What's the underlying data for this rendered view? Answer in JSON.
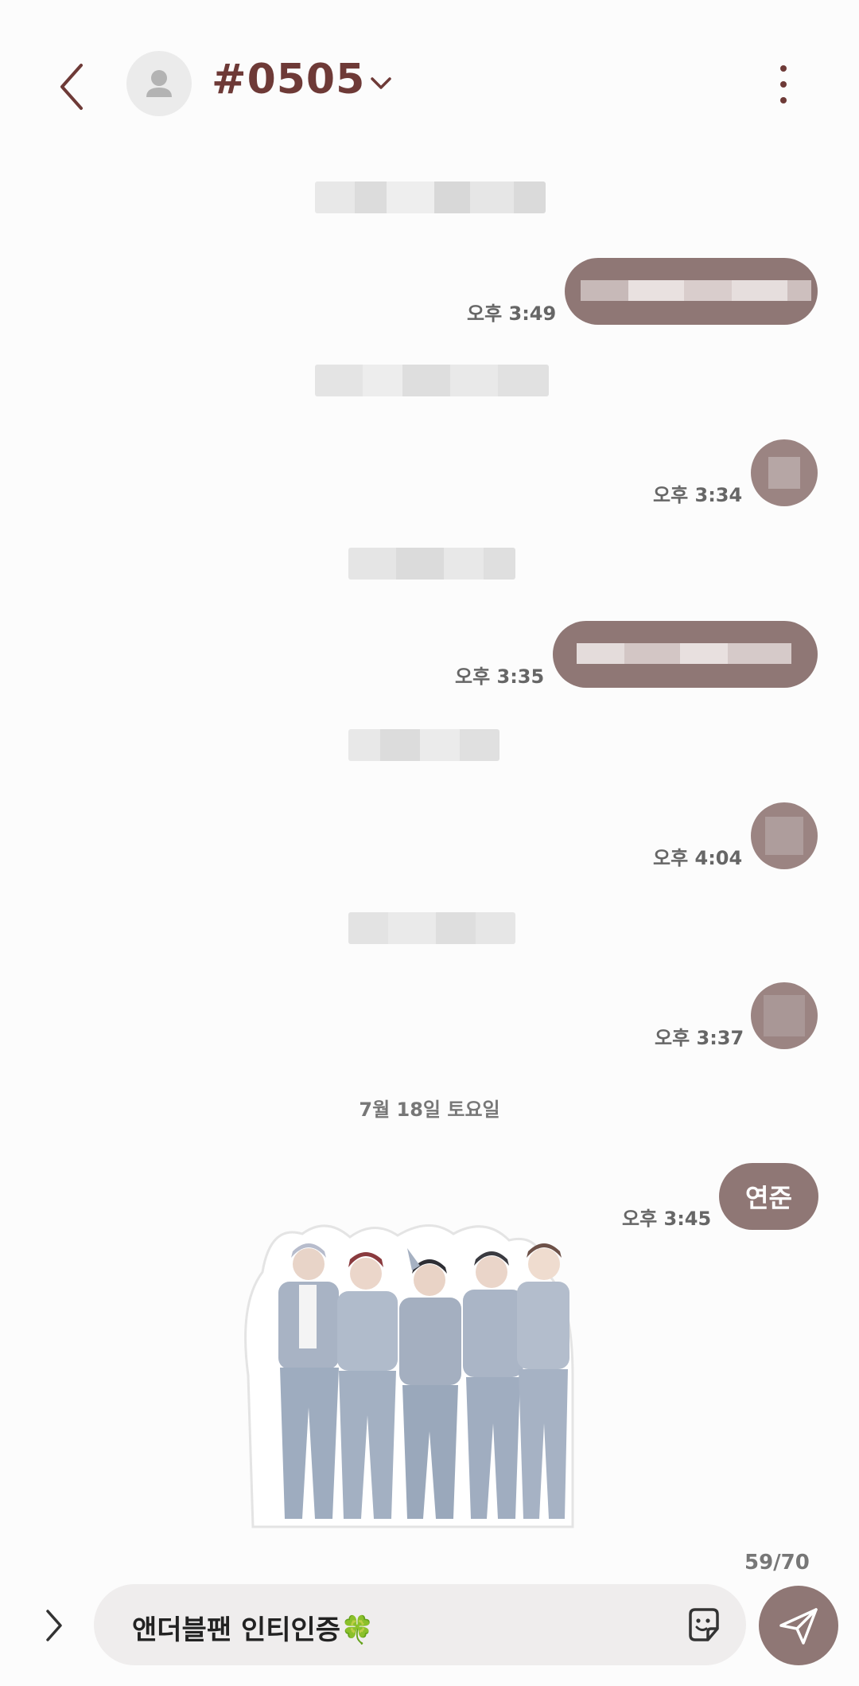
{
  "header": {
    "back_icon": "chevron-left-icon",
    "avatar_icon": "person-icon",
    "title": "#0505",
    "title_dropdown_icon": "chevron-down-icon",
    "more_icon": "more-vertical-icon"
  },
  "messages": [
    {
      "time": "오후 3:49"
    },
    {
      "time": "오후 3:34"
    },
    {
      "time": "오후 3:35"
    },
    {
      "time": "오후 4:04"
    },
    {
      "time": "오후 3:37"
    }
  ],
  "date_separator": "7월 18일 토요일",
  "last_message": {
    "text": "연준",
    "time": "오후 3:45"
  },
  "composer": {
    "char_counter": "59/70",
    "input_value": "앤더블팬 인티인증🍀",
    "expand_icon": "chevron-right-icon",
    "sticker_icon": "sticker-icon",
    "send_icon": "send-icon"
  },
  "colors": {
    "accent": "#6e3a37",
    "bubble": "#8f7775",
    "background": "#fcfcfc"
  }
}
